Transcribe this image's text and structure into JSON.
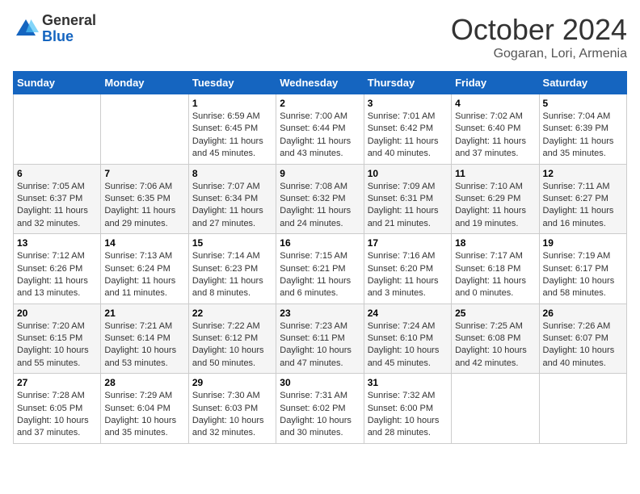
{
  "logo": {
    "general": "General",
    "blue": "Blue"
  },
  "title": "October 2024",
  "subtitle": "Gogaran, Lori, Armenia",
  "days_of_week": [
    "Sunday",
    "Monday",
    "Tuesday",
    "Wednesday",
    "Thursday",
    "Friday",
    "Saturday"
  ],
  "weeks": [
    [
      {
        "day": "",
        "sunrise": "",
        "sunset": "",
        "daylight": ""
      },
      {
        "day": "",
        "sunrise": "",
        "sunset": "",
        "daylight": ""
      },
      {
        "day": "1",
        "sunrise": "Sunrise: 6:59 AM",
        "sunset": "Sunset: 6:45 PM",
        "daylight": "Daylight: 11 hours and 45 minutes."
      },
      {
        "day": "2",
        "sunrise": "Sunrise: 7:00 AM",
        "sunset": "Sunset: 6:44 PM",
        "daylight": "Daylight: 11 hours and 43 minutes."
      },
      {
        "day": "3",
        "sunrise": "Sunrise: 7:01 AM",
        "sunset": "Sunset: 6:42 PM",
        "daylight": "Daylight: 11 hours and 40 minutes."
      },
      {
        "day": "4",
        "sunrise": "Sunrise: 7:02 AM",
        "sunset": "Sunset: 6:40 PM",
        "daylight": "Daylight: 11 hours and 37 minutes."
      },
      {
        "day": "5",
        "sunrise": "Sunrise: 7:04 AM",
        "sunset": "Sunset: 6:39 PM",
        "daylight": "Daylight: 11 hours and 35 minutes."
      }
    ],
    [
      {
        "day": "6",
        "sunrise": "Sunrise: 7:05 AM",
        "sunset": "Sunset: 6:37 PM",
        "daylight": "Daylight: 11 hours and 32 minutes."
      },
      {
        "day": "7",
        "sunrise": "Sunrise: 7:06 AM",
        "sunset": "Sunset: 6:35 PM",
        "daylight": "Daylight: 11 hours and 29 minutes."
      },
      {
        "day": "8",
        "sunrise": "Sunrise: 7:07 AM",
        "sunset": "Sunset: 6:34 PM",
        "daylight": "Daylight: 11 hours and 27 minutes."
      },
      {
        "day": "9",
        "sunrise": "Sunrise: 7:08 AM",
        "sunset": "Sunset: 6:32 PM",
        "daylight": "Daylight: 11 hours and 24 minutes."
      },
      {
        "day": "10",
        "sunrise": "Sunrise: 7:09 AM",
        "sunset": "Sunset: 6:31 PM",
        "daylight": "Daylight: 11 hours and 21 minutes."
      },
      {
        "day": "11",
        "sunrise": "Sunrise: 7:10 AM",
        "sunset": "Sunset: 6:29 PM",
        "daylight": "Daylight: 11 hours and 19 minutes."
      },
      {
        "day": "12",
        "sunrise": "Sunrise: 7:11 AM",
        "sunset": "Sunset: 6:27 PM",
        "daylight": "Daylight: 11 hours and 16 minutes."
      }
    ],
    [
      {
        "day": "13",
        "sunrise": "Sunrise: 7:12 AM",
        "sunset": "Sunset: 6:26 PM",
        "daylight": "Daylight: 11 hours and 13 minutes."
      },
      {
        "day": "14",
        "sunrise": "Sunrise: 7:13 AM",
        "sunset": "Sunset: 6:24 PM",
        "daylight": "Daylight: 11 hours and 11 minutes."
      },
      {
        "day": "15",
        "sunrise": "Sunrise: 7:14 AM",
        "sunset": "Sunset: 6:23 PM",
        "daylight": "Daylight: 11 hours and 8 minutes."
      },
      {
        "day": "16",
        "sunrise": "Sunrise: 7:15 AM",
        "sunset": "Sunset: 6:21 PM",
        "daylight": "Daylight: 11 hours and 6 minutes."
      },
      {
        "day": "17",
        "sunrise": "Sunrise: 7:16 AM",
        "sunset": "Sunset: 6:20 PM",
        "daylight": "Daylight: 11 hours and 3 minutes."
      },
      {
        "day": "18",
        "sunrise": "Sunrise: 7:17 AM",
        "sunset": "Sunset: 6:18 PM",
        "daylight": "Daylight: 11 hours and 0 minutes."
      },
      {
        "day": "19",
        "sunrise": "Sunrise: 7:19 AM",
        "sunset": "Sunset: 6:17 PM",
        "daylight": "Daylight: 10 hours and 58 minutes."
      }
    ],
    [
      {
        "day": "20",
        "sunrise": "Sunrise: 7:20 AM",
        "sunset": "Sunset: 6:15 PM",
        "daylight": "Daylight: 10 hours and 55 minutes."
      },
      {
        "day": "21",
        "sunrise": "Sunrise: 7:21 AM",
        "sunset": "Sunset: 6:14 PM",
        "daylight": "Daylight: 10 hours and 53 minutes."
      },
      {
        "day": "22",
        "sunrise": "Sunrise: 7:22 AM",
        "sunset": "Sunset: 6:12 PM",
        "daylight": "Daylight: 10 hours and 50 minutes."
      },
      {
        "day": "23",
        "sunrise": "Sunrise: 7:23 AM",
        "sunset": "Sunset: 6:11 PM",
        "daylight": "Daylight: 10 hours and 47 minutes."
      },
      {
        "day": "24",
        "sunrise": "Sunrise: 7:24 AM",
        "sunset": "Sunset: 6:10 PM",
        "daylight": "Daylight: 10 hours and 45 minutes."
      },
      {
        "day": "25",
        "sunrise": "Sunrise: 7:25 AM",
        "sunset": "Sunset: 6:08 PM",
        "daylight": "Daylight: 10 hours and 42 minutes."
      },
      {
        "day": "26",
        "sunrise": "Sunrise: 7:26 AM",
        "sunset": "Sunset: 6:07 PM",
        "daylight": "Daylight: 10 hours and 40 minutes."
      }
    ],
    [
      {
        "day": "27",
        "sunrise": "Sunrise: 7:28 AM",
        "sunset": "Sunset: 6:05 PM",
        "daylight": "Daylight: 10 hours and 37 minutes."
      },
      {
        "day": "28",
        "sunrise": "Sunrise: 7:29 AM",
        "sunset": "Sunset: 6:04 PM",
        "daylight": "Daylight: 10 hours and 35 minutes."
      },
      {
        "day": "29",
        "sunrise": "Sunrise: 7:30 AM",
        "sunset": "Sunset: 6:03 PM",
        "daylight": "Daylight: 10 hours and 32 minutes."
      },
      {
        "day": "30",
        "sunrise": "Sunrise: 7:31 AM",
        "sunset": "Sunset: 6:02 PM",
        "daylight": "Daylight: 10 hours and 30 minutes."
      },
      {
        "day": "31",
        "sunrise": "Sunrise: 7:32 AM",
        "sunset": "Sunset: 6:00 PM",
        "daylight": "Daylight: 10 hours and 28 minutes."
      },
      {
        "day": "",
        "sunrise": "",
        "sunset": "",
        "daylight": ""
      },
      {
        "day": "",
        "sunrise": "",
        "sunset": "",
        "daylight": ""
      }
    ]
  ]
}
